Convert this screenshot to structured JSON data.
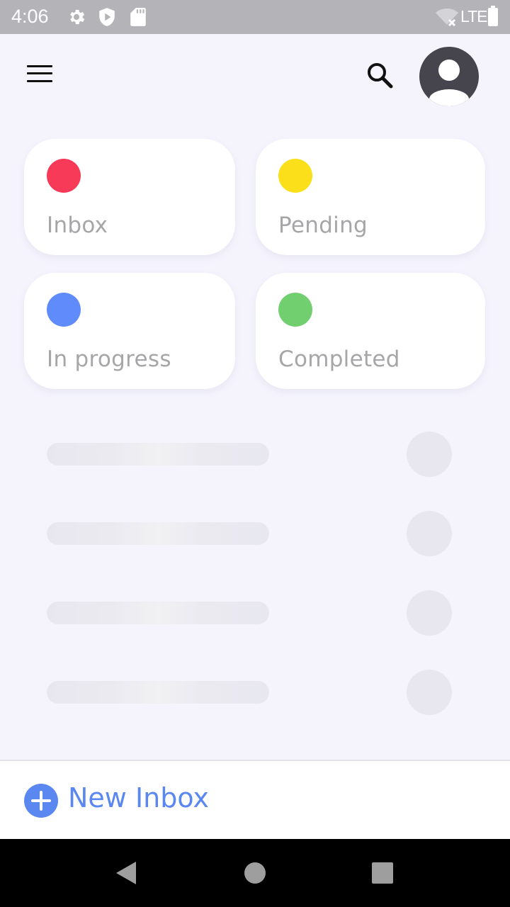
{
  "status_bar": {
    "time": "4:06",
    "network": "LTE",
    "icons": [
      "gear-icon",
      "shield-play-icon",
      "sd-card-icon",
      "wifi-off-icon",
      "battery-icon"
    ]
  },
  "header": {
    "menu_icon": "menu-icon",
    "search_icon": "search-icon",
    "avatar_icon": "account-circle-icon"
  },
  "categories": [
    {
      "label": "Inbox",
      "color": "#f63a57"
    },
    {
      "label": "Pending",
      "color": "#fcdf1b"
    },
    {
      "label": "In progress",
      "color": "#5f8bfb"
    },
    {
      "label": "Completed",
      "color": "#72cf70"
    }
  ],
  "skeleton_rows": 4,
  "bottom_action": {
    "label": "New Inbox",
    "icon": "plus-circle-icon",
    "color": "#5b87f0"
  },
  "nav_bar": {
    "buttons": [
      "back-icon",
      "home-icon",
      "recents-icon"
    ]
  }
}
